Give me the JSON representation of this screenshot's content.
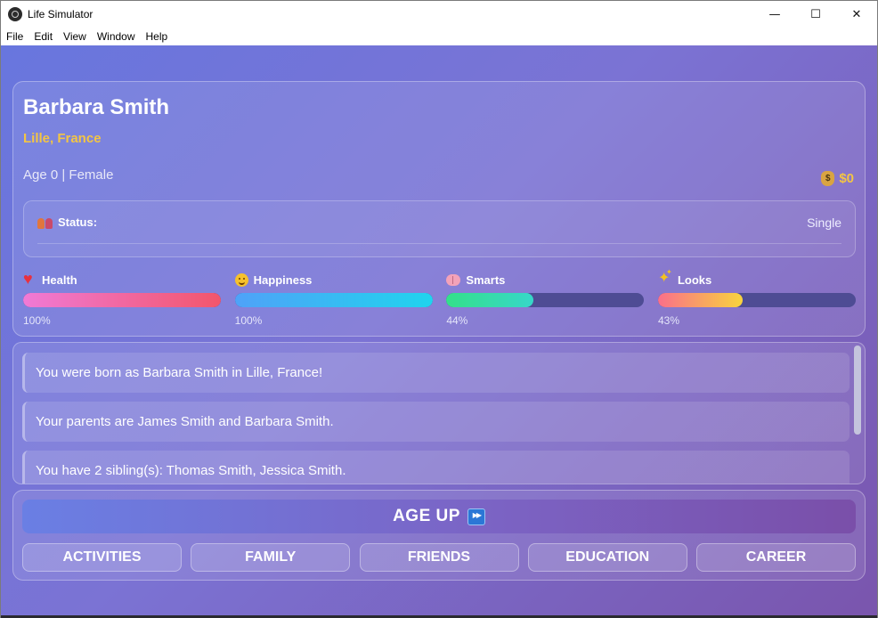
{
  "window": {
    "title": "Life Simulator",
    "controls": {
      "minimize": "—",
      "maximize": "☐",
      "close": "✕"
    }
  },
  "menu": {
    "items": [
      "File",
      "Edit",
      "View",
      "Window",
      "Help"
    ]
  },
  "profile": {
    "name": "Barbara Smith",
    "location": "Lille, France",
    "age_gender": "Age 0 | Female",
    "money": "$0",
    "status_label": "Status:",
    "status_value": "Single"
  },
  "stats": [
    {
      "label": "Health",
      "value": 100,
      "display": "100%",
      "icon": "heart-icon",
      "gradient": [
        "#f07ad6",
        "#f2566b"
      ]
    },
    {
      "label": "Happiness",
      "value": 100,
      "display": "100%",
      "icon": "smile-icon",
      "gradient": [
        "#4fa2f8",
        "#20d4ee"
      ]
    },
    {
      "label": "Smarts",
      "value": 44,
      "display": "44%",
      "icon": "brain-icon",
      "gradient": [
        "#34e08a",
        "#37d7c9"
      ]
    },
    {
      "label": "Looks",
      "value": 43,
      "display": "43%",
      "icon": "sparkles-icon",
      "gradient": [
        "#fa6f8a",
        "#f8d43d"
      ]
    }
  ],
  "log": {
    "entries": [
      "You were born as Barbara Smith in Lille, France!",
      "Your parents are James Smith and Barbara Smith.",
      "You have 2 sibling(s): Thomas Smith, Jessica Smith."
    ]
  },
  "actions": {
    "age_up": "AGE UP",
    "age_up_icon": "fast-forward-icon",
    "tabs": [
      "ACTIVITIES",
      "FAMILY",
      "FRIENDS",
      "EDUCATION",
      "CAREER"
    ]
  }
}
